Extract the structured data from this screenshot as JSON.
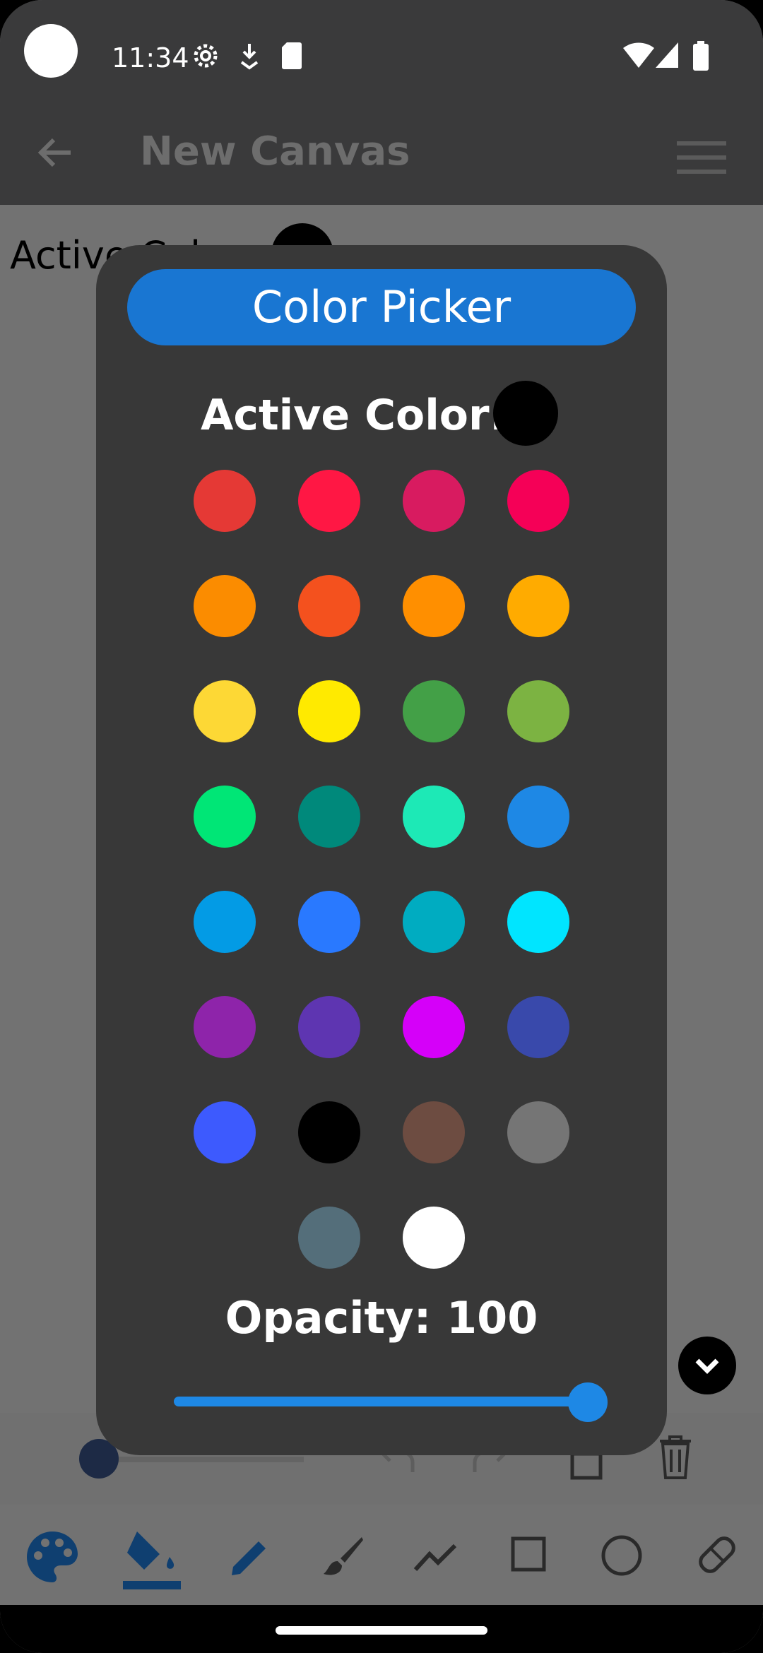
{
  "status_bar": {
    "time": "11:34",
    "icons": [
      "settings-gear-icon",
      "download-icon",
      "sd-card-icon",
      "wifi-icon",
      "signal-icon",
      "battery-icon"
    ]
  },
  "app_bar": {
    "title": "New Canvas",
    "back_icon": "arrow-back-icon",
    "menu_icon": "hamburger-menu-icon"
  },
  "canvas": {
    "active_color_label": "Active Color:",
    "active_color": "#000000"
  },
  "dialog": {
    "title": "Color Picker",
    "active_color_label": "Active Color:",
    "active_color": "#000000",
    "swatches": [
      "#e53935",
      "#ff1744",
      "#d81b60",
      "#f50057",
      "#fb8c00",
      "#f4511e",
      "#ff8f00",
      "#ffab00",
      "#fdd835",
      "#ffea00",
      "#43a047",
      "#7cb342",
      "#00e676",
      "#00897b",
      "#1de9b6",
      "#1e88e5",
      "#039be5",
      "#2979ff",
      "#00acc1",
      "#00e5ff",
      "#8e24aa",
      "#5e35b1",
      "#d500f9",
      "#3949ab",
      "#3d5afe",
      "#000000",
      "#6d4c41",
      "#757575",
      "#546e7a",
      "#ffffff"
    ],
    "opacity_label": "Opacity: 100",
    "opacity_value": 100,
    "opacity_max": 100
  },
  "toolbar": {
    "top_icons": [
      "undo-icon",
      "redo-icon",
      "rotate-icon",
      "trash-icon"
    ],
    "bottom_icons": [
      "palette-icon",
      "fill-bucket-icon",
      "pencil-icon",
      "brush-icon",
      "line-icon",
      "rectangle-icon",
      "circle-icon",
      "eraser-icon"
    ]
  },
  "colors": {
    "dialog_bg": "#383838",
    "accent": "#1976d2",
    "scrim": "#727272"
  }
}
